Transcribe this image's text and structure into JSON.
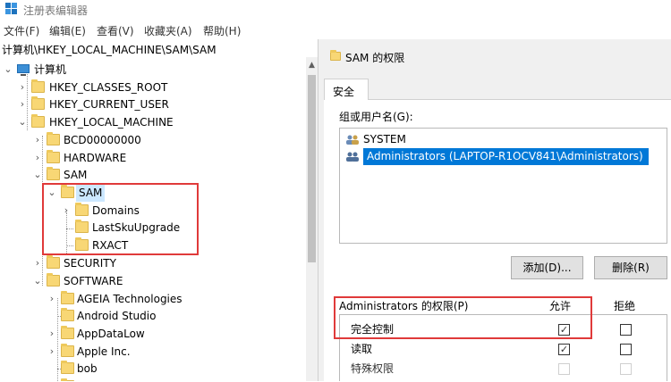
{
  "window": {
    "title": "注册表编辑器"
  },
  "menu": [
    "文件(F)",
    "编辑(E)",
    "查看(V)",
    "收藏夹(A)",
    "帮助(H)"
  ],
  "address": "计算机\\HKEY_LOCAL_MACHINE\\SAM\\SAM",
  "tree": {
    "root": "计算机",
    "hkcr": "HKEY_CLASSES_ROOT",
    "hkcu": "HKEY_CURRENT_USER",
    "hklm": "HKEY_LOCAL_MACHINE",
    "bcd": "BCD00000000",
    "hardware": "HARDWARE",
    "sam_parent": "SAM",
    "sam_selected": "SAM",
    "domains": "Domains",
    "lastsku": "LastSkuUpgrade",
    "rxact": "RXACT",
    "security": "SECURITY",
    "software": "SOFTWARE",
    "ageia": "AGEIA Technologies",
    "android": "Android Studio",
    "appdatalow": "AppDataLow",
    "apple": "Apple Inc.",
    "bob": "bob"
  },
  "dialog": {
    "title": "SAM 的权限",
    "tab": "安全",
    "group_label": "组或用户名(G):",
    "users": [
      {
        "name": "SYSTEM",
        "selected": false
      },
      {
        "name": "Administrators (LAPTOP-R1OCV841\\Administrators)",
        "selected": true
      }
    ],
    "add_button": "添加(D)...",
    "remove_button": "删除(R)",
    "perm_header": "Administrators 的权限(P)",
    "allow_header": "允许",
    "deny_header": "拒绝",
    "permissions": [
      {
        "name": "完全控制",
        "allow": true,
        "deny": false,
        "enabled": true
      },
      {
        "name": "读取",
        "allow": true,
        "deny": false,
        "enabled": true
      },
      {
        "name": "特殊权限",
        "allow": false,
        "deny": false,
        "enabled": false
      }
    ]
  },
  "colors": {
    "highlight_box": "#e03a3a",
    "selected_user": "#0078d7",
    "tree_selection": "#cce8ff",
    "folder": "#f8d775"
  }
}
